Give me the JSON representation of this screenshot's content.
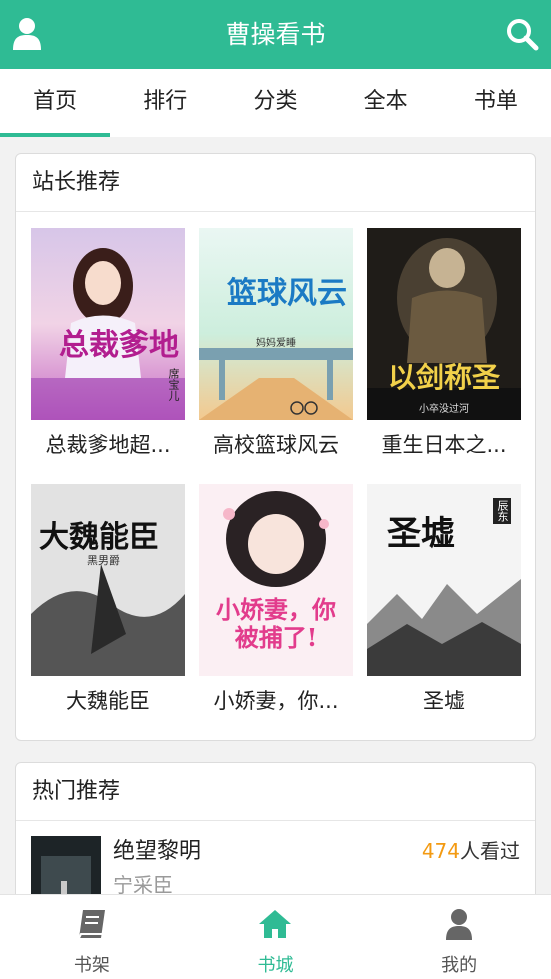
{
  "header": {
    "title": "曹操看书",
    "user_icon": "user-icon",
    "search_icon": "search-icon"
  },
  "tabs": [
    {
      "label": "首页",
      "active": true
    },
    {
      "label": "排行"
    },
    {
      "label": "分类"
    },
    {
      "label": "全本"
    },
    {
      "label": "书单"
    }
  ],
  "recommend": {
    "title": "站长推荐",
    "books": [
      {
        "name": "总裁爹地超...",
        "cover_title": "总裁爹地",
        "cover_author": "席宝儿"
      },
      {
        "name": "高校篮球风云",
        "cover_title": "篮球风云",
        "cover_author": "妈妈爱睡"
      },
      {
        "name": "重生日本之...",
        "cover_title": "以剑称圣",
        "cover_author": "小卒没过河"
      },
      {
        "name": "大魏能臣",
        "cover_title": "大魏能臣",
        "cover_author": "黑男爵"
      },
      {
        "name": "小娇妻，你...",
        "cover_title": "小娇妻，你被捕了!",
        "cover_author": ""
      },
      {
        "name": "圣墟",
        "cover_title": "圣墟",
        "cover_author": "辰东"
      }
    ]
  },
  "hot": {
    "title": "热门推荐",
    "items": [
      {
        "title": "绝望黎明",
        "author": "宁采臣",
        "count": "474",
        "count_suffix": "人看过"
      }
    ]
  },
  "bottom_nav": [
    {
      "label": "书架",
      "icon": "book-icon"
    },
    {
      "label": "书城",
      "icon": "home-icon",
      "active": true
    },
    {
      "label": "我的",
      "icon": "user-icon"
    }
  ],
  "colors": {
    "primary": "#2fbb94",
    "accent_count": "#f39a12"
  }
}
